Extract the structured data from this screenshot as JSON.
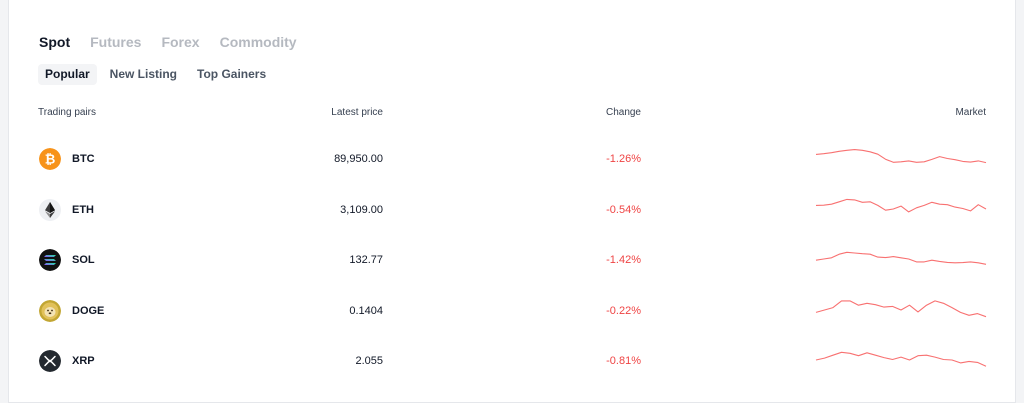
{
  "market_tabs": [
    "Spot",
    "Futures",
    "Forex",
    "Commodity"
  ],
  "sub_tabs": [
    "Popular",
    "New Listing",
    "Top Gainers"
  ],
  "headers": {
    "pair": "Trading pairs",
    "price": "Latest price",
    "change": "Change",
    "market": "Market"
  },
  "colors": {
    "negative": "#ef4444",
    "sparkline": "#f87171"
  },
  "rows": [
    {
      "symbol": "BTC",
      "icon": "bitcoin-icon",
      "price": "89,950.00",
      "change": "-1.26%",
      "trend": [
        0.35,
        0.32,
        0.28,
        0.22,
        0.18,
        0.15,
        0.18,
        0.24,
        0.34,
        0.55,
        0.68,
        0.66,
        0.62,
        0.68,
        0.66,
        0.56,
        0.44,
        0.52,
        0.57,
        0.64,
        0.67,
        0.62,
        0.69
      ]
    },
    {
      "symbol": "ETH",
      "icon": "ethereum-icon",
      "price": "3,109.00",
      "change": "-0.54%",
      "trend": [
        0.35,
        0.34,
        0.3,
        0.2,
        0.1,
        0.12,
        0.22,
        0.2,
        0.35,
        0.55,
        0.5,
        0.38,
        0.62,
        0.45,
        0.35,
        0.22,
        0.3,
        0.32,
        0.42,
        0.48,
        0.58,
        0.32,
        0.5
      ]
    },
    {
      "symbol": "SOL",
      "icon": "solana-icon",
      "price": "132.77",
      "change": "-1.42%",
      "trend": [
        0.55,
        0.5,
        0.45,
        0.3,
        0.22,
        0.25,
        0.28,
        0.3,
        0.42,
        0.44,
        0.4,
        0.45,
        0.5,
        0.62,
        0.62,
        0.55,
        0.6,
        0.64,
        0.66,
        0.65,
        0.62,
        0.66,
        0.72
      ]
    },
    {
      "symbol": "DOGE",
      "icon": "dogecoin-icon",
      "price": "0.1404",
      "change": "-0.22%",
      "trend": [
        0.6,
        0.5,
        0.4,
        0.12,
        0.12,
        0.3,
        0.22,
        0.28,
        0.38,
        0.35,
        0.5,
        0.3,
        0.58,
        0.3,
        0.12,
        0.22,
        0.4,
        0.6,
        0.72,
        0.65,
        0.78
      ]
    },
    {
      "symbol": "XRP",
      "icon": "xrp-icon",
      "price": "2.055",
      "change": "-0.81%",
      "trend": [
        0.5,
        0.42,
        0.3,
        0.18,
        0.22,
        0.32,
        0.2,
        0.3,
        0.4,
        0.48,
        0.38,
        0.5,
        0.32,
        0.3,
        0.38,
        0.48,
        0.5,
        0.62,
        0.56,
        0.6,
        0.76
      ]
    }
  ]
}
